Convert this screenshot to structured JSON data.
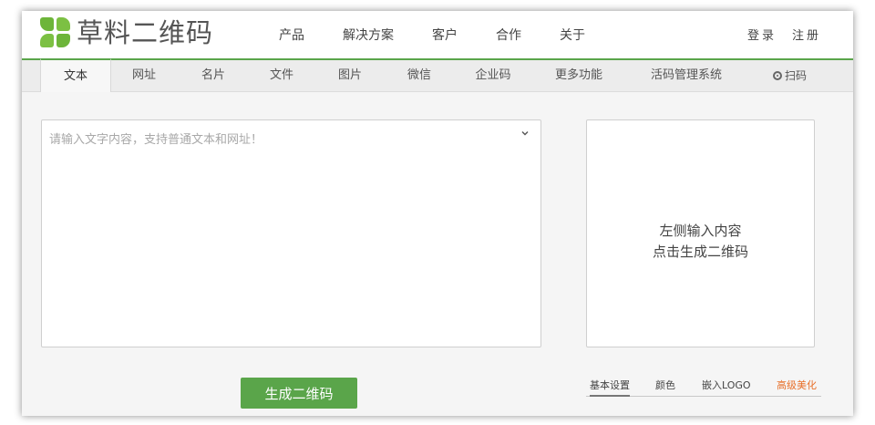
{
  "header": {
    "logo_text": "草料二维码",
    "nav": [
      "产品",
      "解决方案",
      "客户",
      "合作",
      "关于"
    ],
    "login": "登录",
    "register": "注册"
  },
  "tabs": [
    "文本",
    "网址",
    "名片",
    "文件",
    "图片",
    "微信",
    "企业码",
    "更多功能",
    "活码管理系统"
  ],
  "scan_label": "扫码",
  "editor": {
    "placeholder": "请输入文字内容，支持普通文本和网址！"
  },
  "preview": {
    "line1": "左侧输入内容",
    "line2": "点击生成二维码"
  },
  "generate_label": "生成二维码",
  "options": [
    "基本设置",
    "颜色",
    "嵌入LOGO",
    "高级美化"
  ],
  "colors": {
    "accent": "#5aa54a",
    "highlight": "#e8702a"
  }
}
